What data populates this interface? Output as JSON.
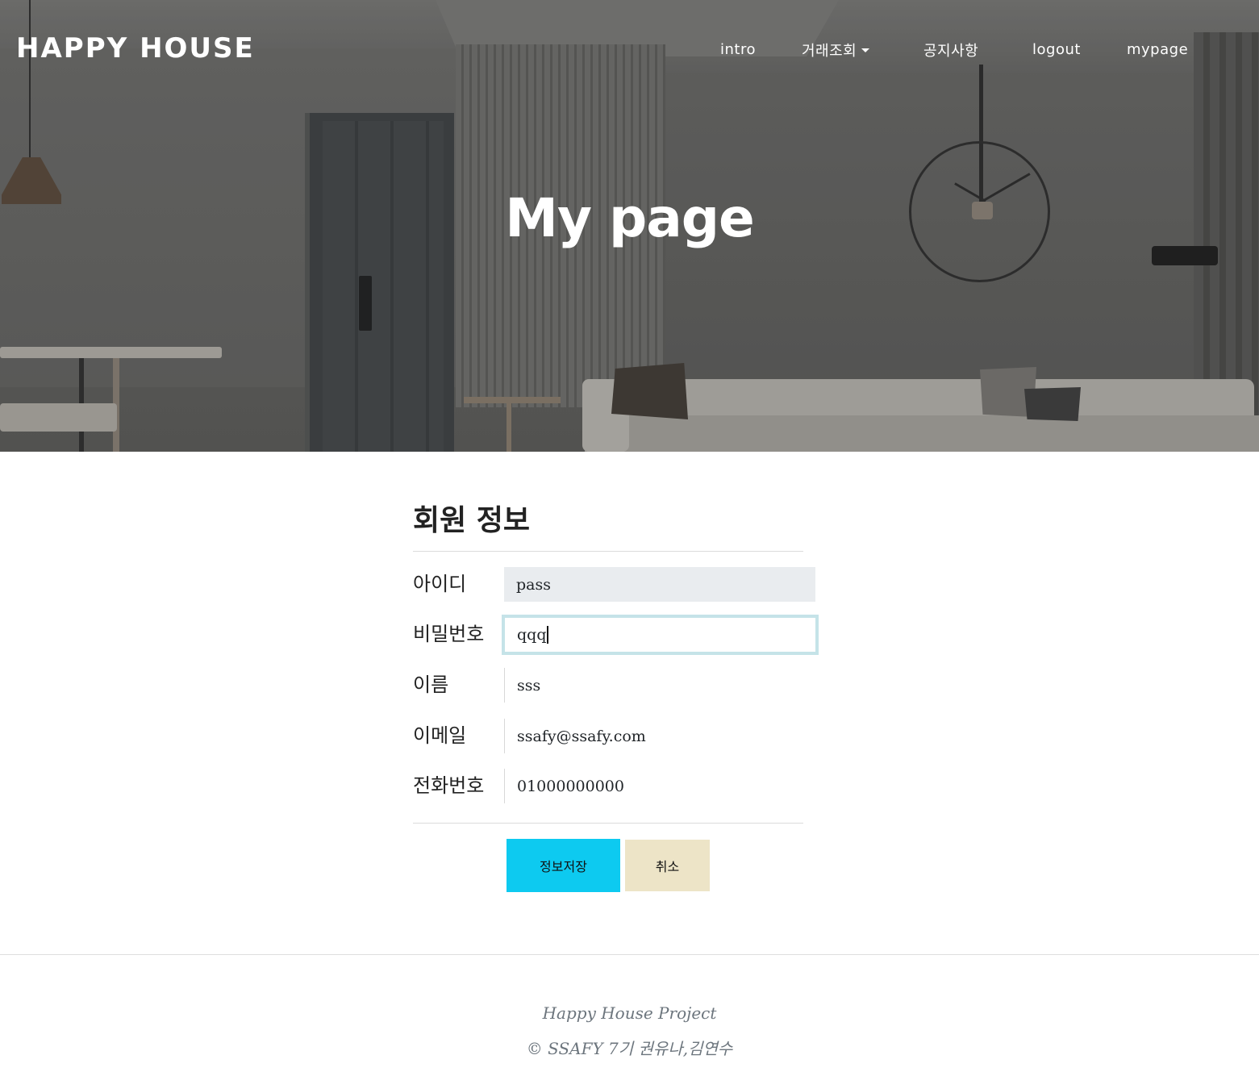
{
  "navbar": {
    "brand": "HAPPY HOUSE",
    "items": [
      {
        "label": "intro"
      },
      {
        "label": "거래조회",
        "dropdown": true
      },
      {
        "label": "공지사항"
      },
      {
        "label": "logout"
      },
      {
        "label": "mypage"
      }
    ]
  },
  "hero": {
    "title": "My page"
  },
  "form": {
    "title": "회원 정보",
    "fields": [
      {
        "label": "아이디",
        "value": "pass",
        "readonly": true
      },
      {
        "label": "비밀번호",
        "value": "qqq",
        "focused": true
      },
      {
        "label": "이름",
        "value": "sss"
      },
      {
        "label": "이메일",
        "value": "ssafy@ssafy.com"
      },
      {
        "label": "전화번호",
        "value": "01000000000"
      }
    ],
    "buttons": {
      "save": "정보저장",
      "cancel": "취소"
    }
  },
  "footer": {
    "line1": "Happy House Project",
    "line2": "© SSAFY 7기 권유나,김연수"
  },
  "colors": {
    "save_button": "#0dcaf0",
    "cancel_button": "#ede4c7",
    "readonly_field": "#e9ecef",
    "focus_ring": "#c5e3e8"
  }
}
